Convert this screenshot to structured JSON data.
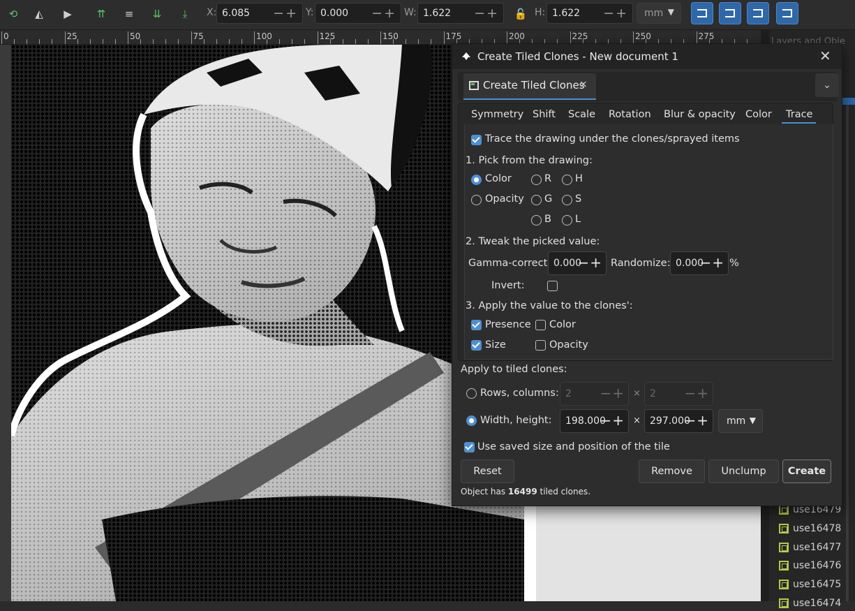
{
  "toolbar": {
    "x_label": "X:",
    "x_value": "6.085",
    "y_label": "Y:",
    "y_value": "0.000",
    "w_label": "W:",
    "w_value": "1.622",
    "h_label": "H:",
    "h_value": "1.622",
    "unit": "mm"
  },
  "ruler": {
    "labels": [
      "0",
      "25",
      "50",
      "75",
      "100",
      "125",
      "150",
      "175",
      "200",
      "225",
      "250",
      "275"
    ]
  },
  "side_panel": {
    "tab_label": "Layers and Obje",
    "objects": [
      "use16479",
      "use16478",
      "use16477",
      "use16476",
      "use16475",
      "use16474"
    ]
  },
  "dialog": {
    "title": "Create Tiled Clones - New document 1",
    "tab_label": "Create Tiled Clones",
    "tab_close": "×",
    "subtabs": [
      "Symmetry",
      "Shift",
      "Scale",
      "Rotation",
      "Blur & opacity",
      "Color",
      "Trace"
    ],
    "active_subtab": "Trace",
    "trace": {
      "trace_checkbox_label": "Trace the drawing under the clones/sprayed items",
      "trace_checked": true,
      "section1": "1. Pick from the drawing:",
      "pick": {
        "color": "Color",
        "opacity": "Opacity",
        "r": "R",
        "g": "G",
        "b": "B",
        "h": "H",
        "s": "S",
        "l": "L",
        "selected": "Color"
      },
      "section2": "2. Tweak the picked value:",
      "gamma_label": "Gamma-correct:",
      "gamma_value": "0.000",
      "randomize_label": "Randomize:",
      "randomize_value": "0.000",
      "randomize_unit": "%",
      "invert_label": "Invert:",
      "invert_checked": false,
      "section3": "3. Apply the value to the clones':",
      "apply": {
        "presence": "Presence",
        "presence_checked": true,
        "size": "Size",
        "size_checked": true,
        "color": "Color",
        "color_checked": false,
        "opacity": "Opacity",
        "opacity_checked": false
      }
    },
    "apply_tiled_label": "Apply to tiled clones:",
    "rows_cols_label": "Rows, columns:",
    "rows_value": "2",
    "cols_value": "2",
    "times": "×",
    "width_height_label": "Width, height:",
    "width_value": "198.0000",
    "height_value": "297.0000",
    "unit": "mm",
    "selected_mode": "width_height",
    "use_saved_label": "Use saved size and position of the tile",
    "use_saved_checked": true,
    "buttons": {
      "reset": "Reset",
      "remove": "Remove",
      "unclump": "Unclump",
      "create": "Create"
    },
    "status_prefix": "Object has ",
    "status_count": "16499",
    "status_suffix": " tiled clones."
  },
  "colors": {
    "accent": "#4f8fd1",
    "toolbar_button": "#2f68a8",
    "dialog_bg": "#2d2d2d"
  }
}
